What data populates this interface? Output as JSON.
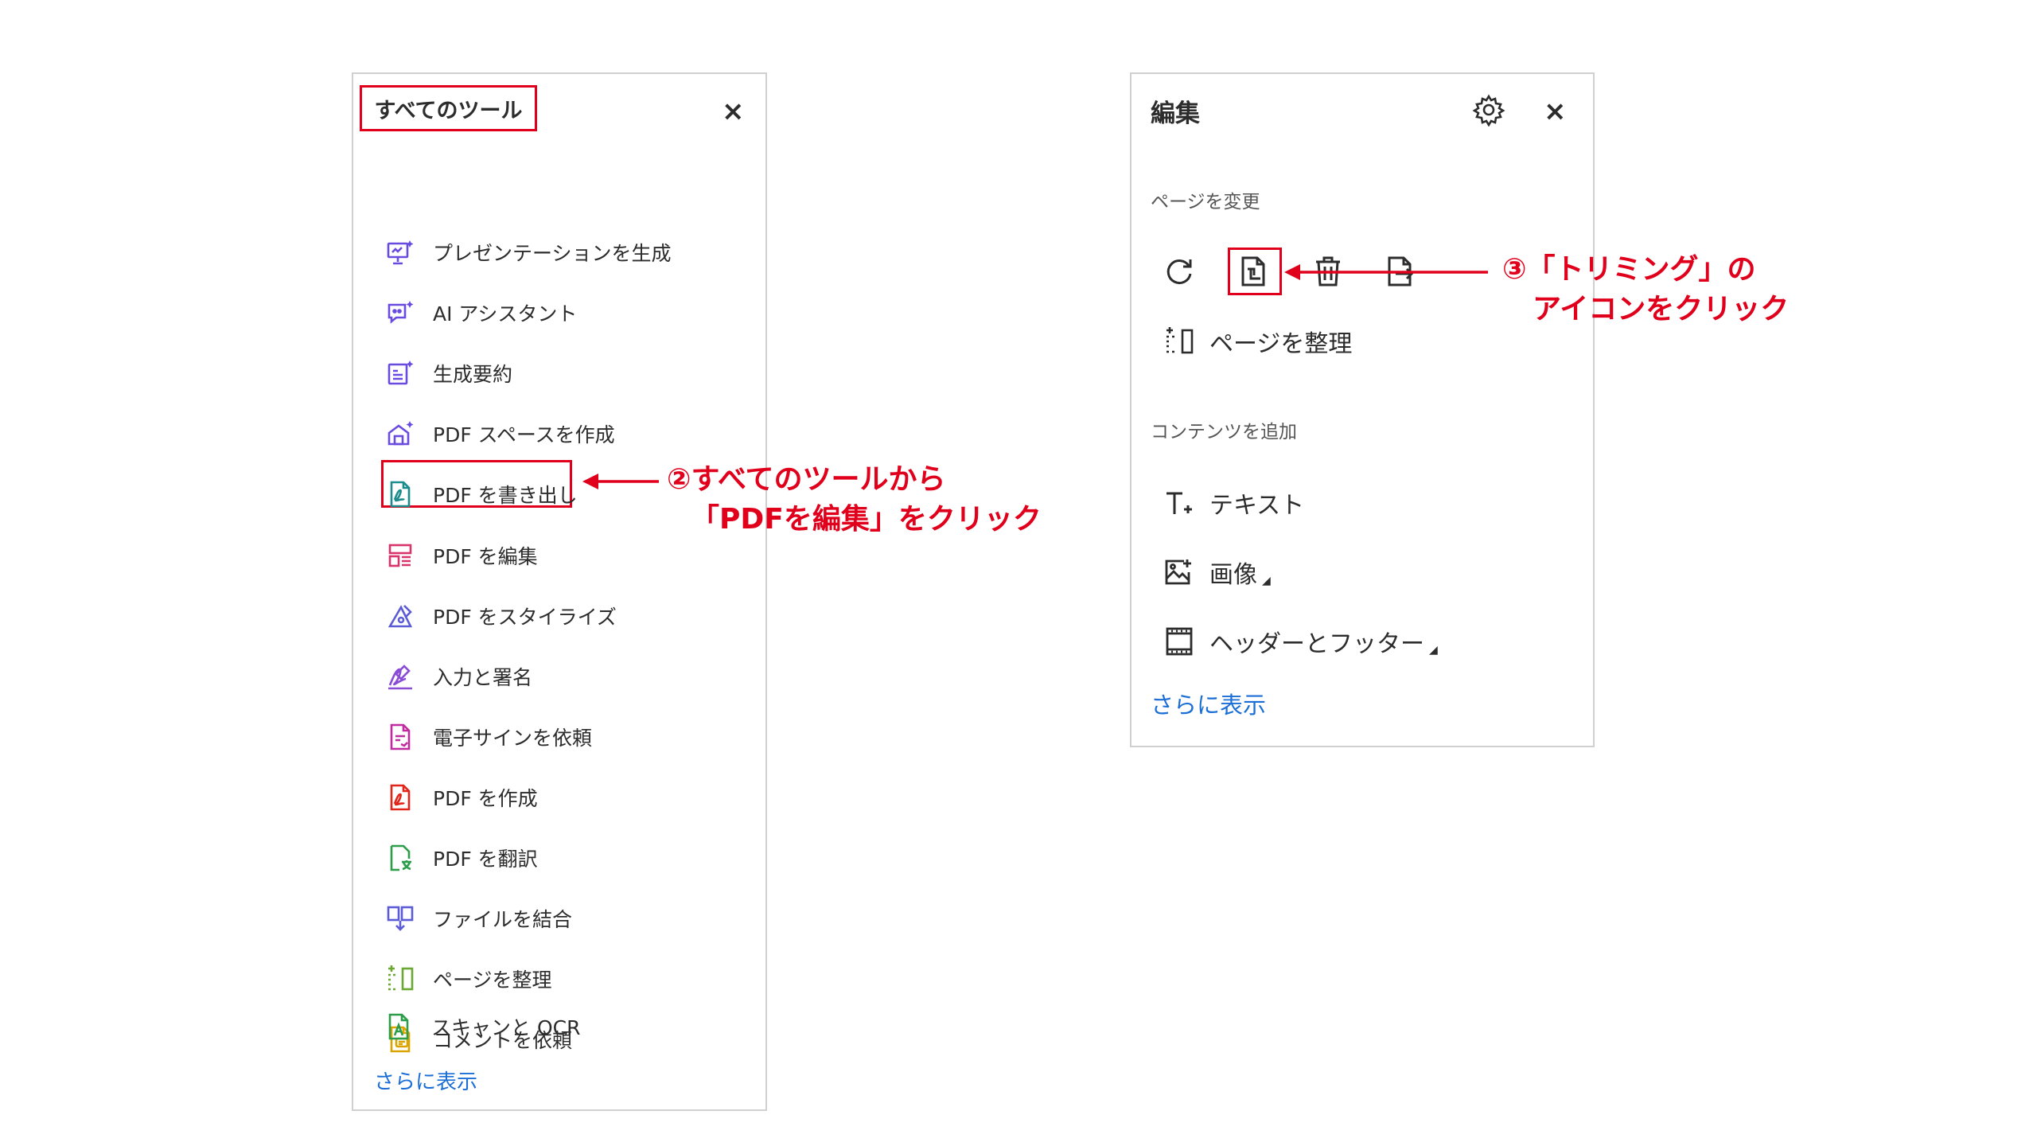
{
  "left_panel": {
    "title": "すべてのツール",
    "close": "×",
    "items": [
      {
        "label": "プレゼンテーションを生成",
        "icon": "presentation-sparkle-icon",
        "color": "#6a4be0"
      },
      {
        "label": "AI アシスタント",
        "icon": "ai-assistant-icon",
        "color": "#6a4be0"
      },
      {
        "label": "生成要約",
        "icon": "generative-summary-icon",
        "color": "#6a4be0"
      },
      {
        "label": "PDF スペースを作成",
        "icon": "pdf-space-icon",
        "color": "#6a4be0"
      },
      {
        "label": "PDF を書き出し",
        "icon": "export-pdf-icon",
        "color": "#1a8c8c"
      },
      {
        "label": "PDF を編集",
        "icon": "edit-pdf-icon",
        "color": "#d8336b"
      },
      {
        "label": "PDF をスタイライズ",
        "icon": "stylize-pdf-icon",
        "color": "#5b5bd6"
      },
      {
        "label": "入力と署名",
        "icon": "fill-sign-icon",
        "color": "#8a4bd6"
      },
      {
        "label": "電子サインを依頼",
        "icon": "request-esign-icon",
        "color": "#c02ca0"
      },
      {
        "label": "PDF を作成",
        "icon": "create-pdf-icon",
        "color": "#e1251b"
      },
      {
        "label": "PDF を翻訳",
        "icon": "translate-pdf-icon",
        "color": "#2c9e4a"
      },
      {
        "label": "ファイルを結合",
        "icon": "combine-files-icon",
        "color": "#5b5bd6"
      },
      {
        "label": "ページを整理",
        "icon": "organize-pages-icon",
        "color": "#6aa832"
      },
      {
        "label": "コメントを依頼",
        "icon": "request-comments-icon",
        "color": "#d9a400"
      },
      {
        "label": "スキャンと OCR",
        "icon": "scan-ocr-icon",
        "color": "#2c9e4a"
      }
    ],
    "more": "さらに表示"
  },
  "right_panel": {
    "title": "編集",
    "close": "×",
    "section_pages": "ページを変更",
    "organize_label": "ページを整理",
    "section_content": "コンテンツを追加",
    "text_label": "テキスト",
    "image_label": "画像",
    "header_footer_label": "ヘッダーとフッター",
    "more": "さらに表示"
  },
  "annotations": {
    "step2_line1": "②すべてのツールから",
    "step2_line2": "「PDFを編集」をクリック",
    "step3_line1": "③「トリミング」の",
    "step3_line2": "アイコンをクリック"
  },
  "colors": {
    "accent_red": "#e1001c",
    "link_blue": "#1b6ed6"
  }
}
